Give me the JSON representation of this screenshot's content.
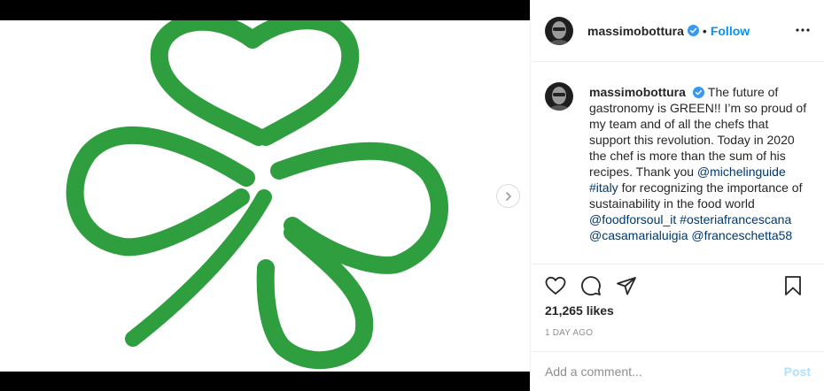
{
  "header": {
    "username": "massimobottura",
    "separator": "•",
    "follow_label": "Follow",
    "more_icon": "more-horizontal-icon"
  },
  "caption": {
    "username": "massimobottura",
    "text_1": "The future of gastronomy is GREEN!! I’m so proud of my team and of all the chefs that support this revolution. Today in 2020 the chef is more than the sum of his recipes. Thank you",
    "mention_1": "@michelinguide",
    "hashtag_1": "#italy",
    "text_2": "for recognizing the importance of sustainability in the food world",
    "hashtag_2": "@foodforsoul_it",
    "hashtag_3": "#osteriafrancescana",
    "mention_2": "@casamarialuigia",
    "mention_3": "@franceschetta58"
  },
  "engagement": {
    "likes": "21,265 likes",
    "time": "1 DAY AGO"
  },
  "comment_box": {
    "placeholder": "Add a comment...",
    "post_label": "Post"
  },
  "colors": {
    "clover_green": "#2f9e3f",
    "link_blue": "#00376b",
    "follow_blue": "#0095f6",
    "verified_blue": "#3897f0"
  },
  "icons": [
    "heart-icon",
    "comment-icon",
    "share-icon",
    "bookmark-icon",
    "chevron-right-icon",
    "verified-badge-icon"
  ]
}
